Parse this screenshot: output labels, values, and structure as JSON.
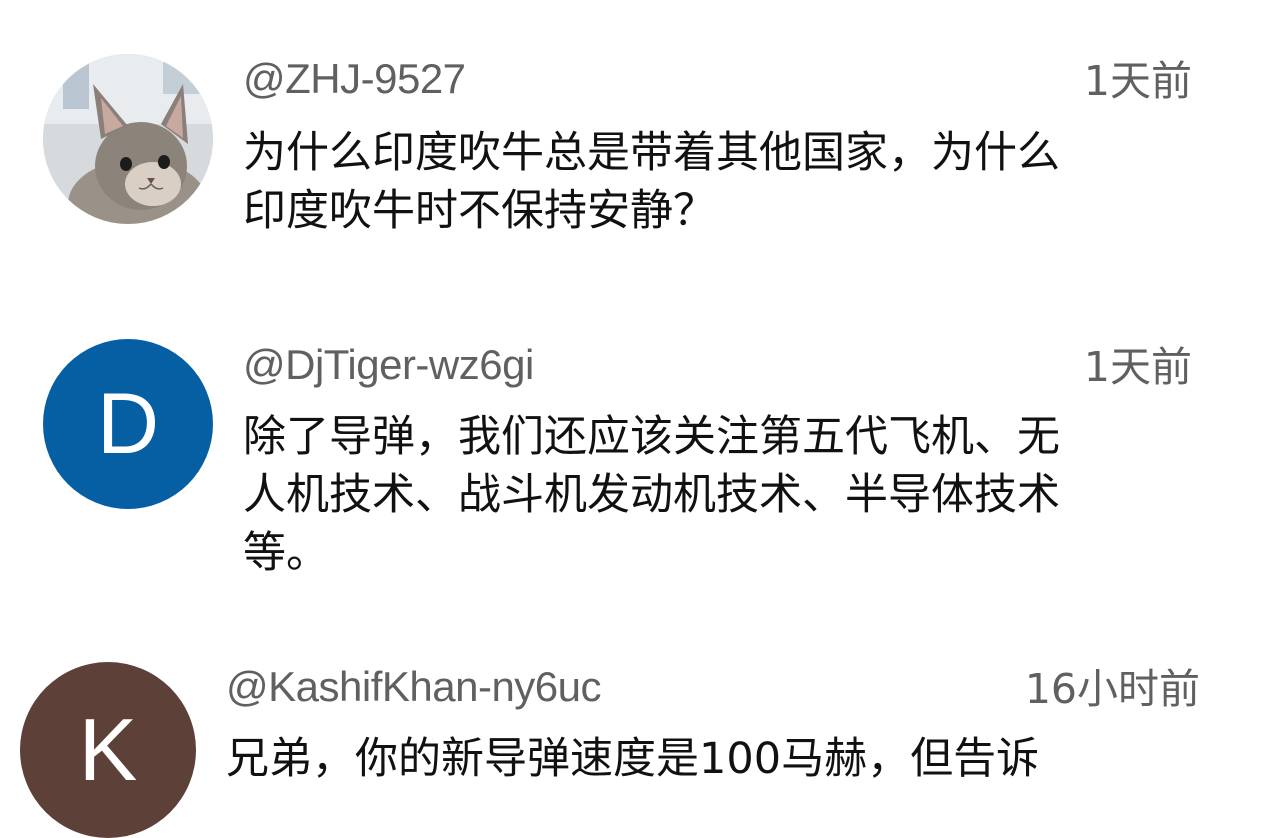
{
  "comments": [
    {
      "author": "@ZHJ-9527",
      "time": "1天前",
      "avatar_icon": "cat-photo-avatar",
      "text_lines": [
        "为什么印度吹牛总是带着其他国家，为什么",
        "印度吹牛时不保持安静？"
      ]
    },
    {
      "author": "@DjTiger-wz6gi",
      "time": "1天前",
      "avatar_letter": "D",
      "avatar_color": "#065fa3",
      "text_lines": [
        "除了导弹，我们还应该关注第五代飞机、无",
        "人机技术、战斗机发动机技术、半导体技术",
        "等。"
      ]
    },
    {
      "author": "@KashifKhan-ny6uc",
      "time": "16小时前",
      "avatar_letter": "K",
      "avatar_color": "#5d4037",
      "text_lines": [
        "兄弟，你的新导弹速度是100马赫，但告诉"
      ]
    }
  ]
}
